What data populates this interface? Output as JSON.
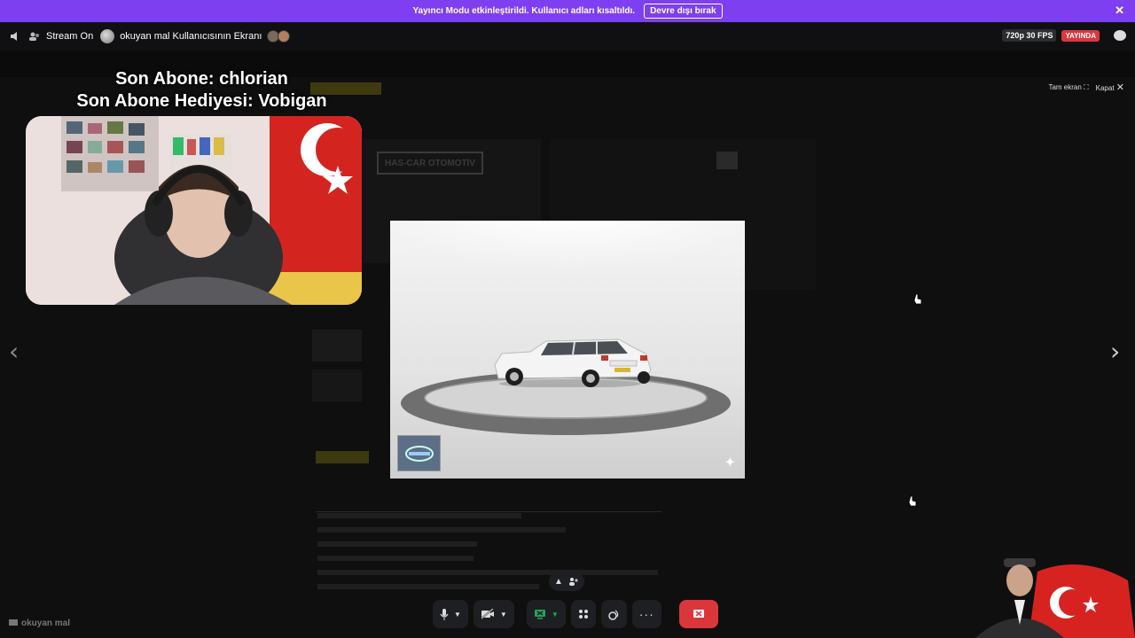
{
  "banner": {
    "message": "Yayıncı Modu etkinleştirildi. Kullanıcı adları kısaltıldı.",
    "button_label": "Devre dışı bırak",
    "close": "✕"
  },
  "stream_bar": {
    "stream_label": "Stream On",
    "screen_title": "okuyan mal Kullanıcısının Ekranı",
    "quality": "720p 30 FPS",
    "live": "YAYINDA"
  },
  "viewer": {
    "fullscreen_label": "Tam ekran",
    "close_label": "Kapat"
  },
  "overlay": {
    "last_sub": "Son Abone: chlorian",
    "last_gift": "Son Abone Hediyesi: Vobigan"
  },
  "shared_screen": {
    "dealer_badge": "HAS-CAR OTOMOTİV"
  },
  "footer": {
    "username": "okuyan mal"
  },
  "icons": {
    "sound": "sound-icon",
    "mic": "microphone-icon",
    "camera": "camera-off-icon",
    "screenshare": "screen-share-icon",
    "activities": "activities-icon",
    "soundboard": "soundboard-icon",
    "more": "more-icon",
    "leave": "leave-call-icon"
  },
  "colors": {
    "streamer_mode": "#7d3ff0",
    "live_red": "#da373c",
    "green": "#23a55a"
  }
}
